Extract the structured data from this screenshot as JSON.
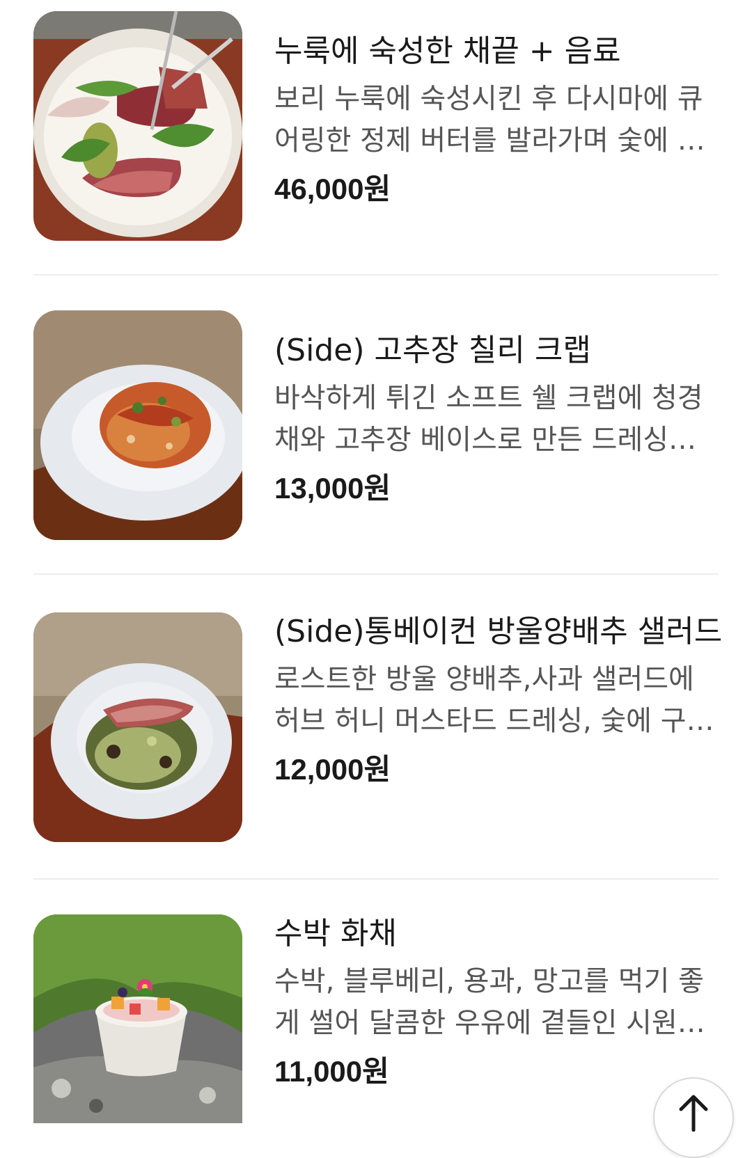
{
  "menu": {
    "items": [
      {
        "name": "누룩에 숙성한 채끝 + 음료",
        "description": "보리 누룩에 숙성시킨 후 다시마에 큐어링한 정제 버터를 발라가며 숯에 …",
        "price": "46,000원"
      },
      {
        "name": "(Side) 고추장 칠리 크랩",
        "description": "바삭하게 튀긴 소프트 쉘 크랩에 청경채와 고추장 베이스로 만든 드레싱…",
        "price": "13,000원"
      },
      {
        "name": "(Side)통베이컨 방울양배추 샐러드",
        "description": "로스트한 방울 양배추,사과 샐러드에 허브 허니 머스타드 드레싱, 숯에 구…",
        "price": "12,000원"
      },
      {
        "name": "수박 화채",
        "description": "수박, 블루베리, 용과, 망고를 먹기 좋게 썰어 달콤한 우유에 곁들인 시원…",
        "price": "11,000원"
      }
    ]
  },
  "scroll_top": {
    "icon": "arrow-up-icon"
  }
}
